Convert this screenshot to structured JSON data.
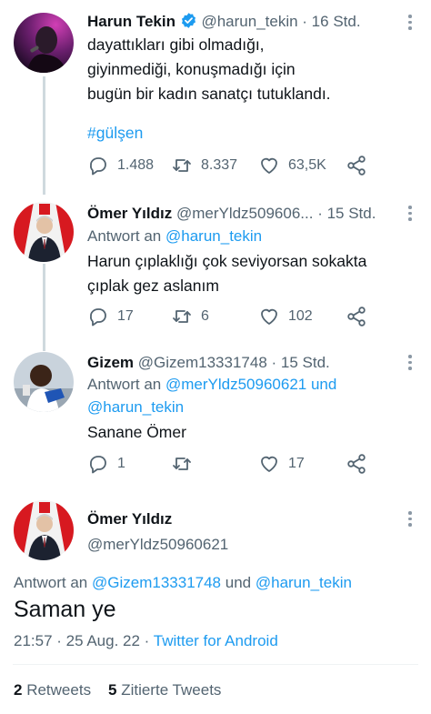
{
  "tweets": [
    {
      "name": "Harun Tekin",
      "handle": "@harun_tekin",
      "time": "· 16 Std.",
      "lines": [
        "dayattıkları gibi olmadığı,",
        "giyinmediği, konuşmadığı için",
        "bugün bir kadın sanatçı tutuklandı."
      ],
      "hashtag": "#gülşen",
      "replies": "1.488",
      "retweets": "8.337",
      "likes": "63,5K"
    },
    {
      "name": "Ömer Yıldız",
      "handle": "@merYldz509606...",
      "time": "· 15 Std.",
      "reply_prefix": "Antwort an",
      "reply_to": "@harun_tekin",
      "lines": [
        "Harun çıplaklığı çok seviyorsan sokakta",
        "çıplak gez aslanım"
      ],
      "replies": "17",
      "retweets": "6",
      "likes": "102"
    },
    {
      "name": "Gizem",
      "handle": "@Gizem13331748",
      "time": "· 15 Std.",
      "reply_prefix": "Antwort an",
      "reply_to_line1": "@merYldz50960621 und",
      "reply_to_line2": "@harun_tekin",
      "lines": [
        "Sanane Ömer"
      ],
      "replies": "1",
      "likes": "17"
    }
  ],
  "focus": {
    "name": "Ömer Yıldız",
    "handle": "@merYldz50960621",
    "reply_prefix": "Antwort an",
    "reply_to_a": "@Gizem13331748",
    "reply_and": "und",
    "reply_to_b": "@harun_tekin",
    "text": "Saman ye",
    "timestamp": "21:57 · 25 Aug. 22 ·",
    "source": "Twitter for Android",
    "retweets_count": "2",
    "retweets_label": "Retweets",
    "quotes_count": "5",
    "quotes_label": "Zitierte Tweets"
  },
  "colors": {
    "accent": "#1d9bf0",
    "muted": "#536471",
    "text": "#0f1419",
    "thread": "#cfd9de"
  }
}
